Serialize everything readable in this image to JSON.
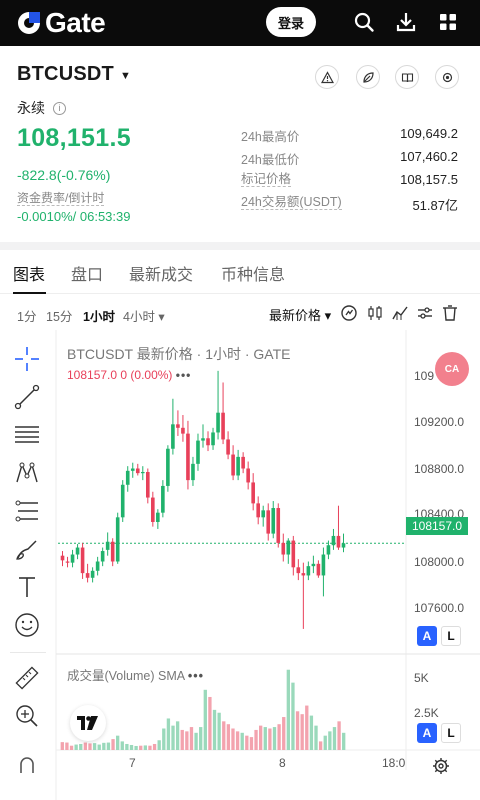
{
  "appbar": {
    "brand": "Gate",
    "login_label": "登录"
  },
  "header": {
    "symbol": "BTCUSDT",
    "contract_type": "永续",
    "last_price": "108,151.5",
    "change": "-822.8(-0.76%)",
    "funding_label": "资金费率/倒计时",
    "funding_value": "-0.0010%/ 06:53:39",
    "stats": [
      {
        "label": "24h最高价",
        "value": "109,649.2"
      },
      {
        "label": "24h最低价",
        "value": "107,460.2"
      },
      {
        "label": "标记价格",
        "value": "108,157.5"
      },
      {
        "label": "24h交易额(USDT)",
        "value": "51.87亿"
      }
    ]
  },
  "tabs": [
    {
      "label": "图表",
      "active": true
    },
    {
      "label": "盘口",
      "active": false
    },
    {
      "label": "最新成交",
      "active": false
    },
    {
      "label": "币种信息",
      "active": false
    }
  ],
  "intervals": [
    {
      "label": "1分",
      "active": false
    },
    {
      "label": "15分",
      "active": false
    },
    {
      "label": "1小时",
      "active": true
    },
    {
      "label": "4小时 ▾",
      "active": false
    }
  ],
  "price_type": "最新价格 ▾",
  "chart": {
    "legend_title": "BTCUSDT 最新价格 · 1小时 · GATE",
    "legend_values": "108157.0  0 (0.00%)",
    "volume_title": "成交量(Volume) SMA",
    "current_price_tag": "108157.0",
    "ca_badge": "CA",
    "price_axis": [
      "109",
      "109200.0",
      "108800.0",
      "108400.0",
      "108000.0",
      "107600.0"
    ],
    "volume_axis": [
      "5K",
      "2.5K"
    ],
    "time_axis": [
      "7",
      "8",
      "18:0"
    ],
    "scale_buttons": [
      "A",
      "L"
    ],
    "colors": {
      "up": "#20b26c",
      "down": "#e8405a",
      "accent": "#2962ff"
    }
  },
  "chart_data": {
    "type": "candlestick",
    "symbol": "BTCUSDT",
    "interval": "1小时",
    "y_ticks": [
      107600,
      108000,
      108400,
      108800,
      109200
    ],
    "ylim": [
      107400,
      109650
    ],
    "last_price": 108157.0,
    "x_ticks": [
      "7",
      "8",
      "18:0"
    ],
    "candles": [
      [
        108050,
        108090,
        107960,
        108010
      ],
      [
        108000,
        108040,
        107950,
        107990
      ],
      [
        107990,
        108100,
        107950,
        108060
      ],
      [
        108060,
        108150,
        108020,
        108120
      ],
      [
        108120,
        108160,
        107850,
        107900
      ],
      [
        107900,
        107980,
        107820,
        107860
      ],
      [
        107860,
        107950,
        107820,
        107920
      ],
      [
        107920,
        108040,
        107880,
        108000
      ],
      [
        108000,
        108120,
        107960,
        108090
      ],
      [
        108100,
        108250,
        108050,
        108170
      ],
      [
        108170,
        108200,
        107960,
        108000
      ],
      [
        108000,
        108420,
        107980,
        108380
      ],
      [
        108380,
        108700,
        108340,
        108660
      ],
      [
        108660,
        108820,
        108600,
        108780
      ],
      [
        108780,
        108850,
        108720,
        108800
      ],
      [
        108800,
        108840,
        108740,
        108760
      ],
      [
        108760,
        108820,
        108700,
        108770
      ],
      [
        108770,
        108800,
        108500,
        108550
      ],
      [
        108550,
        108600,
        108300,
        108340
      ],
      [
        108340,
        108450,
        108280,
        108420
      ],
      [
        108420,
        108700,
        108380,
        108650
      ],
      [
        108650,
        109000,
        108600,
        108970
      ],
      [
        108970,
        109400,
        108920,
        109180
      ],
      [
        109180,
        109300,
        109080,
        109150
      ],
      [
        109150,
        109260,
        109030,
        109100
      ],
      [
        109100,
        109210,
        108620,
        108700
      ],
      [
        108700,
        108900,
        108650,
        108840
      ],
      [
        108840,
        109100,
        108780,
        109040
      ],
      [
        109040,
        109180,
        108980,
        109060
      ],
      [
        109060,
        109120,
        108950,
        109000
      ],
      [
        109000,
        109150,
        108960,
        109110
      ],
      [
        109110,
        109640,
        109050,
        109280
      ],
      [
        109280,
        109540,
        109010,
        109050
      ],
      [
        109050,
        109120,
        108880,
        108920
      ],
      [
        108920,
        109000,
        108700,
        108740
      ],
      [
        108740,
        108960,
        108700,
        108900
      ],
      [
        108900,
        108940,
        108760,
        108800
      ],
      [
        108800,
        108860,
        108620,
        108680
      ],
      [
        108680,
        108760,
        108440,
        108500
      ],
      [
        108500,
        108560,
        108320,
        108380
      ],
      [
        108380,
        108480,
        108300,
        108440
      ],
      [
        108440,
        108500,
        108180,
        108240
      ],
      [
        108240,
        108520,
        108200,
        108460
      ],
      [
        108460,
        108500,
        108120,
        108160
      ],
      [
        108160,
        108240,
        108000,
        108060
      ],
      [
        108060,
        108200,
        107980,
        108180
      ],
      [
        108180,
        108220,
        107880,
        107950
      ],
      [
        107950,
        108020,
        107840,
        107900
      ],
      [
        107900,
        107990,
        107420,
        107880
      ],
      [
        107880,
        108000,
        107840,
        107960
      ],
      [
        107960,
        108050,
        107900,
        107980
      ],
      [
        107980,
        108010,
        107860,
        107880
      ],
      [
        107880,
        108120,
        107700,
        108060
      ],
      [
        108060,
        108180,
        108020,
        108140
      ],
      [
        108140,
        108280,
        108100,
        108220
      ],
      [
        108220,
        108480,
        108100,
        108120
      ],
      [
        108120,
        108240,
        108080,
        108157
      ]
    ],
    "volumes": [
      550,
      520,
      300,
      380,
      420,
      520,
      460,
      480,
      380,
      500,
      520,
      760,
      1000,
      600,
      420,
      350,
      280,
      300,
      320,
      300,
      420,
      680,
      1500,
      2200,
      1700,
      2000,
      1400,
      1300,
      1600,
      1200,
      1600,
      4200,
      3700,
      2800,
      2600,
      2000,
      1800,
      1500,
      1300,
      1200,
      1000,
      900,
      1400,
      1700,
      1600,
      1500,
      1600,
      1800,
      2300,
      5600,
      4700,
      2700,
      2500,
      3100,
      2400,
      1700,
      600,
      1000,
      1300,
      1600,
      2000,
      1200
    ]
  }
}
